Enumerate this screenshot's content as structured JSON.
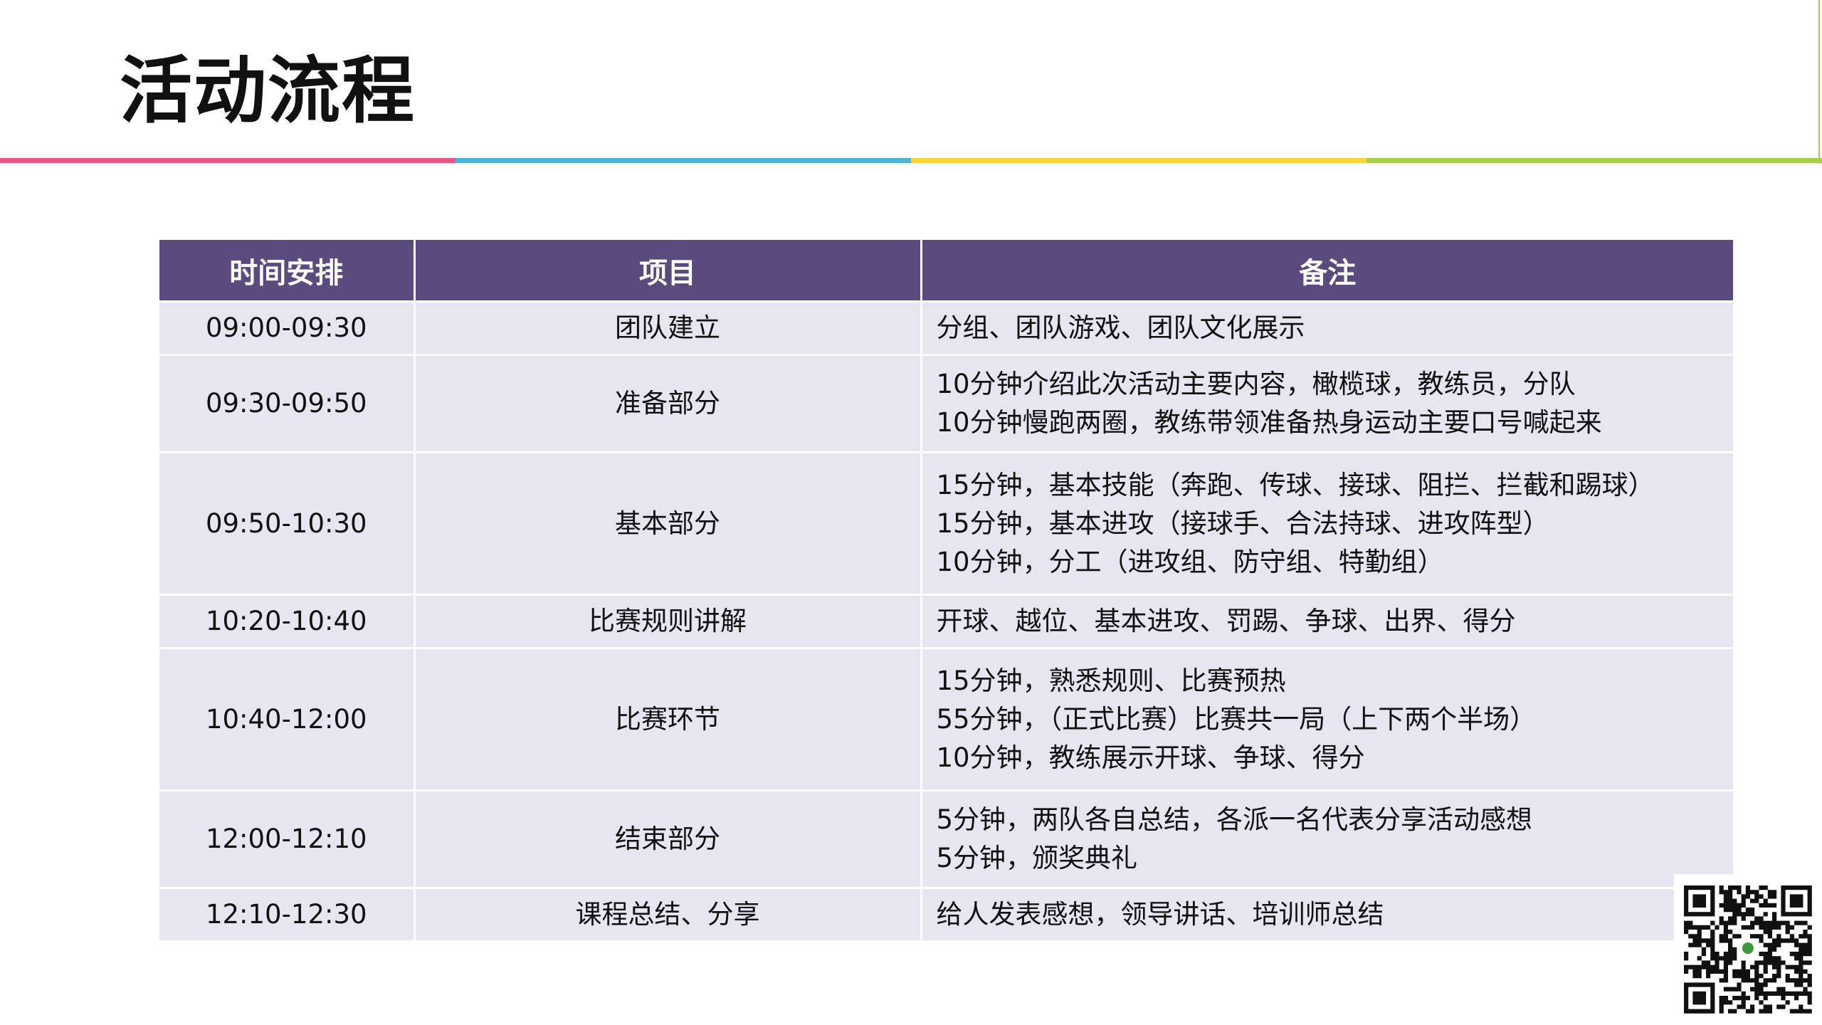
{
  "slide": {
    "title": "活动流程",
    "stripe_colors": [
      "#e8557f",
      "#4fb3e0",
      "#f6d43a",
      "#a8d04a"
    ],
    "header_bg": "#5b4a7d",
    "row_bg": "#e7e6f0"
  },
  "table": {
    "headers": [
      "时间安排",
      "项目",
      "备注"
    ],
    "rows": [
      {
        "time": "09:00-09:30",
        "item": "团队建立",
        "notes": [
          "分组、团队游戏、团队文化展示"
        ]
      },
      {
        "time": "09:30-09:50",
        "item": "准备部分",
        "notes": [
          "10分钟介绍此次活动主要内容，橄榄球，教练员，分队",
          "10分钟慢跑两圈，教练带领准备热身运动主要口号喊起来"
        ]
      },
      {
        "time": "09:50-10:30",
        "item": "基本部分",
        "notes": [
          "15分钟，基本技能（奔跑、传球、接球、阻拦、拦截和踢球）",
          "15分钟，基本进攻（接球手、合法持球、进攻阵型）",
          "10分钟，分工（进攻组、防守组、特勤组）"
        ]
      },
      {
        "time": "10:20-10:40",
        "item": "比赛规则讲解",
        "notes": [
          "开球、越位、基本进攻、罚踢、争球、出界、得分"
        ]
      },
      {
        "time": "10:40-12:00",
        "item": "比赛环节",
        "notes": [
          "15分钟，熟悉规则、比赛预热",
          "55分钟，（正式比赛）比赛共一局（上下两个半场）",
          "10分钟，教练展示开球、争球、得分"
        ]
      },
      {
        "time": "12:00-12:10",
        "item": "结束部分",
        "notes": [
          "5分钟，两队各自总结，各派一名代表分享活动感想",
          "5分钟，颁奖典礼"
        ]
      },
      {
        "time": "12:10-12:30",
        "item": "课程总结、分享",
        "notes": [
          "给人发表感想，领导讲话、培训师总结"
        ]
      }
    ]
  },
  "qr_code": {
    "icon": "qr-code-icon"
  }
}
